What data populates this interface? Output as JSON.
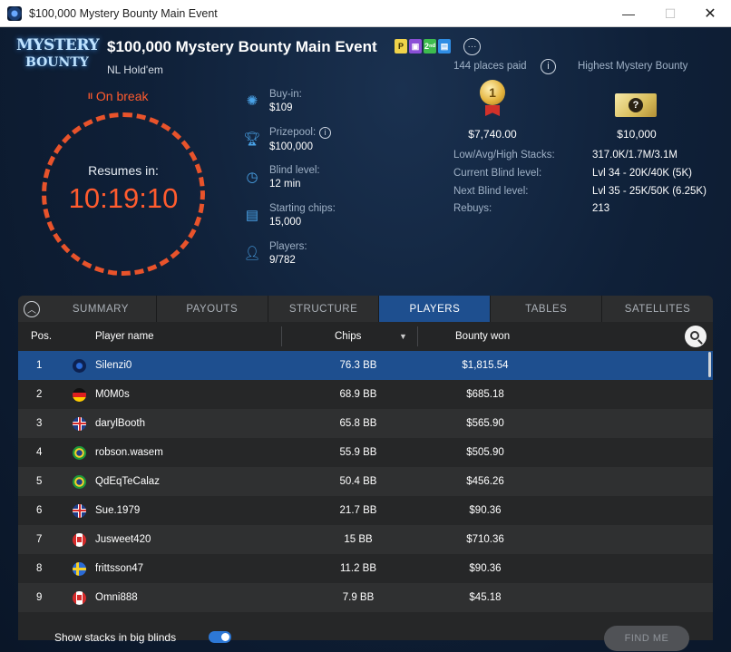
{
  "window": {
    "title": "$100,000 Mystery Bounty Main Event",
    "minimize": "—",
    "maximize": "☐",
    "close": "✕"
  },
  "logo": {
    "line1": "MYSTERY",
    "line2": "BOUNTY"
  },
  "event": {
    "title": "$100,000 Mystery Bounty Main Event",
    "game_type": "NL Hold'em",
    "badges": [
      {
        "label": "P",
        "color": "#f0d34a"
      },
      {
        "label": "▣",
        "color": "#8a4fd6"
      },
      {
        "label": "2ⁿᵈ",
        "color": "#3dbb4e"
      },
      {
        "label": "▤",
        "color": "#2f8de4"
      }
    ],
    "more": "···"
  },
  "status": {
    "break_icon": "II",
    "break_text": "On break",
    "resumes_label": "Resumes in:",
    "timer": "10:19:10"
  },
  "info": {
    "buy_in": {
      "label": "Buy-in:",
      "value": "$109",
      "icon": "chip-icon"
    },
    "prizepool": {
      "label": "Prizepool:",
      "value": "$100,000",
      "icon": "trophy-icon"
    },
    "blind_level": {
      "label": "Blind level:",
      "value": "12 min",
      "icon": "clock-icon"
    },
    "starting_chips": {
      "label": "Starting chips:",
      "value": "15,000",
      "icon": "chips-stack-icon"
    },
    "players": {
      "label": "Players:",
      "value": "9/782",
      "icon": "person-icon"
    },
    "info_glyph": "i"
  },
  "prizes": {
    "places_paid": "144 places paid",
    "highest_label": "Highest Mystery Bounty",
    "first_prize_rank": "1",
    "first_prize": "$7,740.00",
    "ticket_glyph": "?",
    "highest_bounty": "$10,000"
  },
  "stats": [
    {
      "label": "Low/Avg/High Stacks:",
      "value": "317.0K/1.7M/3.1M"
    },
    {
      "label": "Current Blind level:",
      "value": "Lvl 34 - 20K/40K (5K)"
    },
    {
      "label": "Next Blind level:",
      "value": "Lvl 35 - 25K/50K (6.25K)"
    },
    {
      "label": "Rebuys:",
      "value": "213"
    }
  ],
  "tabs": [
    "SUMMARY",
    "PAYOUTS",
    "STRUCTURE",
    "PLAYERS",
    "TABLES",
    "SATELLITES"
  ],
  "active_tab": "PLAYERS",
  "table": {
    "headers": {
      "pos": "Pos.",
      "name": "Player name",
      "chips": "Chips",
      "bounty": "Bounty won",
      "sort_arrow": "▼"
    },
    "rows": [
      {
        "pos": "1",
        "flag": "world",
        "name": "Silenzi0",
        "chips": "76.3 BB",
        "bounty": "$1,815.54",
        "selected": true
      },
      {
        "pos": "2",
        "flag": "de",
        "name": "M0M0s",
        "chips": "68.9 BB",
        "bounty": "$685.18"
      },
      {
        "pos": "3",
        "flag": "uk",
        "name": "darylBooth",
        "chips": "65.8 BB",
        "bounty": "$565.90"
      },
      {
        "pos": "4",
        "flag": "br",
        "name": "robson.wasem",
        "chips": "55.9 BB",
        "bounty": "$505.90"
      },
      {
        "pos": "5",
        "flag": "br",
        "name": "QdEqTeCalaz",
        "chips": "50.4 BB",
        "bounty": "$456.26"
      },
      {
        "pos": "6",
        "flag": "uk",
        "name": "Sue.1979",
        "chips": "21.7 BB",
        "bounty": "$90.36"
      },
      {
        "pos": "7",
        "flag": "ca",
        "name": "Jusweet420",
        "chips": "15 BB",
        "bounty": "$710.36"
      },
      {
        "pos": "8",
        "flag": "se",
        "name": "frittsson47",
        "chips": "11.2 BB",
        "bounty": "$90.36"
      },
      {
        "pos": "9",
        "flag": "ca",
        "name": "Omni888",
        "chips": "7.9 BB",
        "bounty": "$45.18"
      }
    ]
  },
  "footer": {
    "toggle_label": "Show stacks in big blinds",
    "toggle_on": true,
    "find_me": "FIND ME"
  },
  "colors": {
    "accent": "#ff5b2e",
    "active_tab": "#1e4f8f",
    "info_icon": "#4aa3e8"
  }
}
